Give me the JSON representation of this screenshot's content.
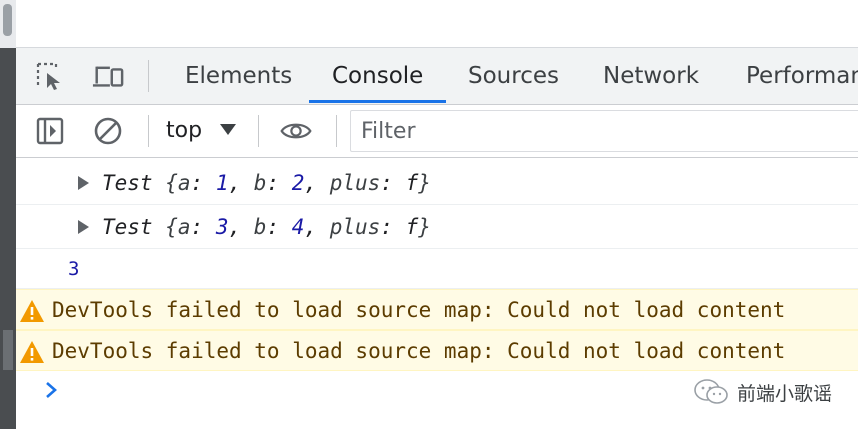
{
  "devtools": {
    "tabs": [
      {
        "label": "Elements",
        "active": false
      },
      {
        "label": "Console",
        "active": true
      },
      {
        "label": "Sources",
        "active": false
      },
      {
        "label": "Network",
        "active": false
      },
      {
        "label": "Performan",
        "active": false
      }
    ],
    "icons": {
      "inspect": "inspect-element-icon",
      "device": "device-toolbar-icon",
      "sidebar": "show-sidebar-icon",
      "clear": "clear-console-icon",
      "eye": "live-expression-eye-icon"
    },
    "accent_color": "#1a73e8"
  },
  "console": {
    "context_selector": "top",
    "filter_placeholder": "Filter",
    "messages": [
      {
        "type": "object",
        "class_name": "Test",
        "brace_open": "{",
        "props": [
          {
            "key": "a",
            "value": "1"
          },
          {
            "key": "b",
            "value": "2"
          },
          {
            "key": "plus",
            "value": "f"
          }
        ],
        "brace_close": "}"
      },
      {
        "type": "object",
        "class_name": "Test",
        "brace_open": "{",
        "props": [
          {
            "key": "a",
            "value": "3"
          },
          {
            "key": "b",
            "value": "4"
          },
          {
            "key": "plus",
            "value": "f"
          }
        ],
        "brace_close": "}"
      },
      {
        "type": "number",
        "value": "3"
      },
      {
        "type": "warning",
        "text": "DevTools failed to load source map: Could not load content"
      },
      {
        "type": "warning",
        "text": "DevTools failed to load source map: Could not load content"
      }
    ],
    "warning_color": "#fffbe5",
    "prompt_symbol": ">"
  },
  "watermark": {
    "text": "前端小歌谣",
    "icon": "wechat-icon"
  }
}
